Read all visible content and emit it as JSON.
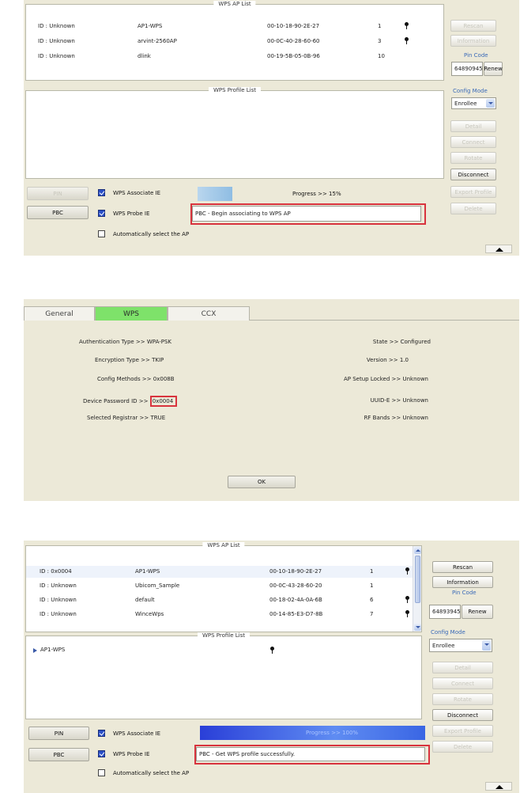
{
  "panel1": {
    "ap_list_title": "WPS AP List",
    "ap_rows": [
      {
        "id": "ID : Unknown",
        "ssid": "AP1-WPS",
        "bssid": "00-10-18-90-2E-27",
        "channel": "1",
        "lock": true
      },
      {
        "id": "ID : Unknown",
        "ssid": "arvint-2560AP",
        "bssid": "00-0C-40-28-60-60",
        "channel": "3",
        "lock": true
      },
      {
        "id": "ID : Unknown",
        "ssid": "dlink",
        "bssid": "00-19-5B-05-0B-96",
        "channel": "10",
        "lock": false
      }
    ],
    "profile_list_title": "WPS Profile List",
    "buttons": {
      "rescan": "Rescan",
      "information": "Information",
      "renew": "Renew",
      "detail": "Detail",
      "connect": "Connect",
      "rotate": "Rotate",
      "disconnect": "Disconnect",
      "export_profile": "Export Profile",
      "delete": "Delete",
      "pin": "PIN",
      "pbc": "PBC"
    },
    "pin_code_label": "Pin Code",
    "pin_code_value": "64890945",
    "config_mode_label": "Config Mode",
    "config_mode_value": "Enrollee",
    "associate_ie_label": "WPS Associate IE",
    "probe_ie_label": "WPS Probe IE",
    "auto_select_label": "Automatically select the AP",
    "progress_text": "Progress >> 15%",
    "progress_value": 0.15,
    "status_text": "PBC - Begin associating to WPS AP"
  },
  "panel2": {
    "tabs": [
      "General",
      "WPS",
      "CCX"
    ],
    "active_tab": "WPS",
    "left_fields": [
      {
        "label": "Authentication Type >>",
        "value": "WPA-PSK"
      },
      {
        "label": "Encryption Type >>",
        "value": "TKIP"
      },
      {
        "label": "Config Methods >>",
        "value": "0x008B"
      },
      {
        "label": "Device Password ID >>",
        "value": "0x0004"
      },
      {
        "label": "Selected Registrar >>",
        "value": "TRUE"
      }
    ],
    "right_fields": [
      {
        "label": "State >>",
        "value": "Configured"
      },
      {
        "label": "Version >>",
        "value": "1.0"
      },
      {
        "label": "AP Setup Locked >>",
        "value": "Unknown"
      },
      {
        "label": "UUID-E >>",
        "value": "Unknown"
      },
      {
        "label": "RF Bands >>",
        "value": "Unknown"
      }
    ],
    "ok_label": "OK"
  },
  "panel3": {
    "ap_list_title": "WPS AP List",
    "ap_rows": [
      {
        "id": "ID : 0x0004",
        "ssid": "AP1-WPS",
        "bssid": "00-10-18-90-2E-27",
        "channel": "1",
        "lock": true
      },
      {
        "id": "ID : Unknown",
        "ssid": "Ubicom_Sample",
        "bssid": "00-0C-43-28-60-20",
        "channel": "1",
        "lock": false
      },
      {
        "id": "ID : Unknown",
        "ssid": "default",
        "bssid": "00-18-02-4A-0A-6B",
        "channel": "6",
        "lock": true
      },
      {
        "id": "ID : Unknown",
        "ssid": "WinceWps",
        "bssid": "00-14-85-E3-D7-8B",
        "channel": "7",
        "lock": true
      }
    ],
    "profile_list_title": "WPS Profile List",
    "profile_items": [
      "AP1-WPS"
    ],
    "buttons": {
      "rescan": "Rescan",
      "information": "Information",
      "renew": "Renew",
      "detail": "Detail",
      "connect": "Connect",
      "rotate": "Rotate",
      "disconnect": "Disconnect",
      "export_profile": "Export Profile",
      "delete": "Delete",
      "pin": "PIN",
      "pbc": "PBC"
    },
    "pin_code_label": "Pin Code",
    "pin_code_value": "64893945",
    "config_mode_label": "Config Mode",
    "config_mode_value": "Enrollee",
    "associate_ie_label": "WPS Associate IE",
    "probe_ie_label": "WPS Probe IE",
    "auto_select_label": "Automatically select the AP",
    "progress_text": "Progress >> 100%",
    "progress_value": 1.0,
    "status_text": "PBC - Get WPS profile successfully."
  },
  "colors": {
    "panel_bg": "#ece9d8",
    "highlight_red": "#d8333d",
    "tab_active_green": "#7ee26a",
    "progress_blue": "#2f52e0",
    "label_blue": "#3a6ab8"
  }
}
